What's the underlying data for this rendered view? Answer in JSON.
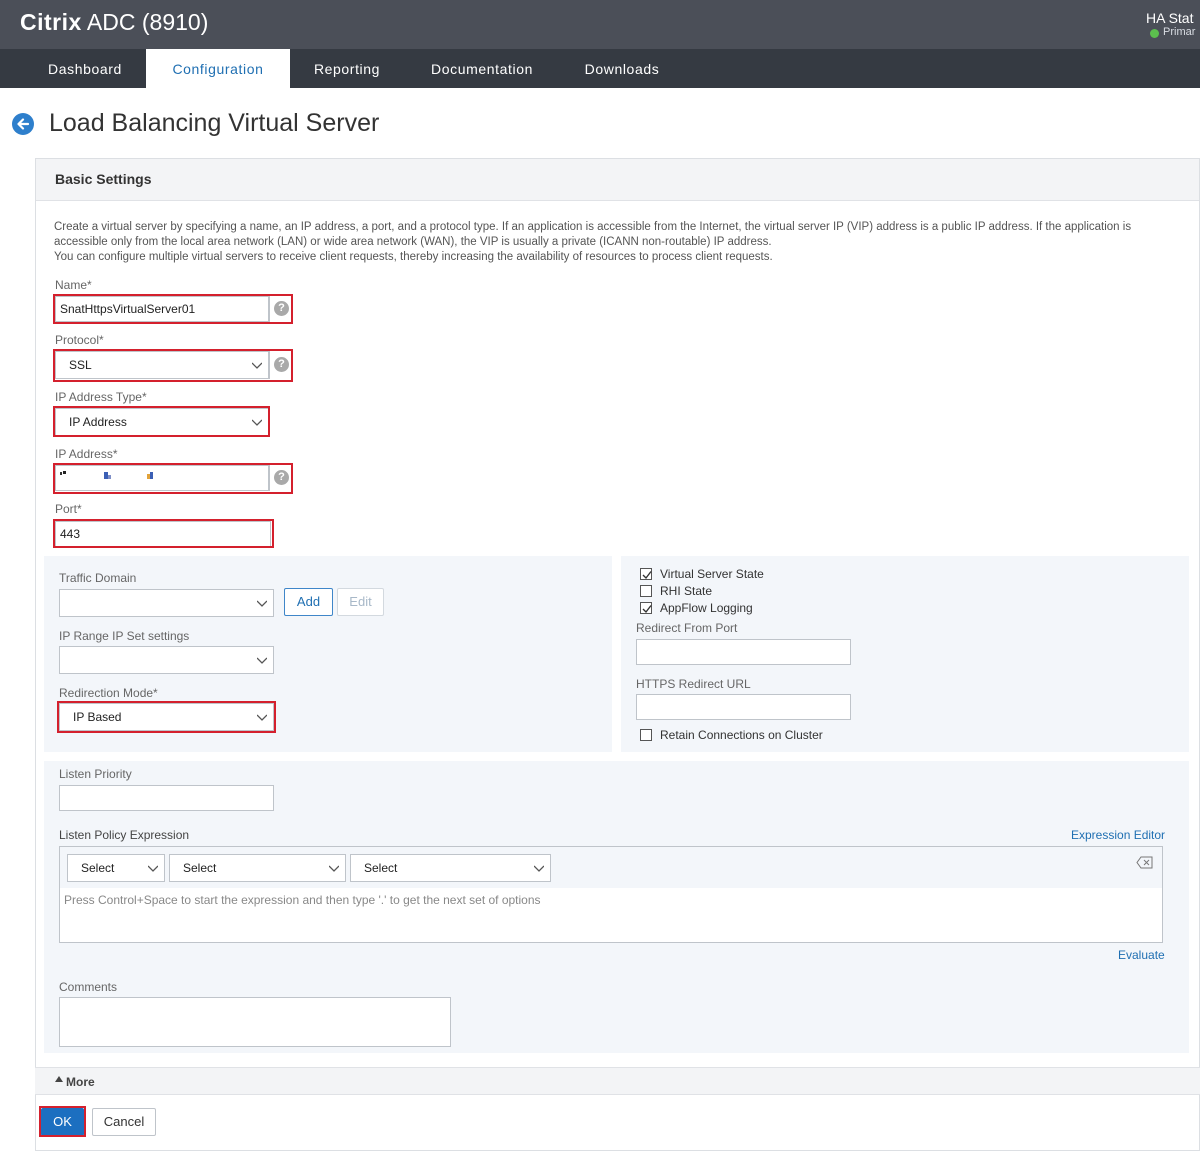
{
  "header": {
    "brand_bold": "Citrix",
    "brand_rest": " ADC (8910)",
    "ha_title": "HA Stat",
    "ha_status": "Primar",
    "ha_status_color": "#5cc04e"
  },
  "nav": {
    "tabs": [
      {
        "label": "Dashboard"
      },
      {
        "label": "Configuration"
      },
      {
        "label": "Reporting"
      },
      {
        "label": "Documentation"
      },
      {
        "label": "Downloads"
      }
    ],
    "active": "Configuration"
  },
  "page": {
    "title": "Load Balancing Virtual Server"
  },
  "panel": {
    "heading": "Basic Settings",
    "description_line1": "Create a virtual server by specifying a name, an IP address, a port, and a protocol type. If an application is accessible from the Internet, the virtual server IP (VIP) address is a public IP address. If the application is accessible only from the local area network (LAN) or wide area network (WAN), the VIP is usually a private (ICANN non-routable) IP address.",
    "description_line2": "You can configure multiple virtual servers to receive client requests, thereby increasing the availability of resources to process client requests."
  },
  "form": {
    "name_label": "Name*",
    "name_value": "SnatHttpsVirtualServer01",
    "protocol_label": "Protocol*",
    "protocol_value": "SSL",
    "ip_type_label": "IP Address Type*",
    "ip_type_value": "IP Address",
    "ip_label": "IP Address*",
    "ip_value": "",
    "port_label": "Port*",
    "port_value": "443",
    "help_glyph": "?"
  },
  "left_sub": {
    "traffic_domain_label": "Traffic Domain",
    "traffic_domain_value": "",
    "add_label": "Add",
    "edit_label": "Edit",
    "ip_range_label": "IP Range IP Set settings",
    "ip_range_value": "",
    "redirection_label": "Redirection Mode*",
    "redirection_value": "IP Based"
  },
  "right_sub": {
    "virtual_server_state_label": "Virtual Server State",
    "virtual_server_state_checked": true,
    "rhi_state_label": "RHI State",
    "rhi_state_checked": false,
    "appflow_label": "AppFlow Logging",
    "appflow_checked": true,
    "redirect_from_port_label": "Redirect From Port",
    "redirect_from_port_value": "",
    "https_redirect_label": "HTTPS Redirect URL",
    "https_redirect_value": "",
    "retain_label": "Retain Connections on Cluster",
    "retain_checked": false
  },
  "listen": {
    "priority_label": "Listen Priority",
    "priority_value": "",
    "policy_label": "Listen Policy Expression",
    "expression_editor_label": "Expression Editor",
    "select1": "Select",
    "select2": "Select",
    "select3": "Select",
    "hint": "Press Control+Space to start the expression and then type '.' to get the next set of options",
    "evaluate_label": "Evaluate",
    "comments_label": "Comments",
    "comments_value": ""
  },
  "footer": {
    "more_label": "More",
    "ok_label": "OK",
    "cancel_label": "Cancel"
  },
  "colors": {
    "header_bg": "#4b4f58",
    "nav_bg": "#353a42",
    "accent": "#1f6fb2",
    "highlight_red": "#d4202d"
  }
}
